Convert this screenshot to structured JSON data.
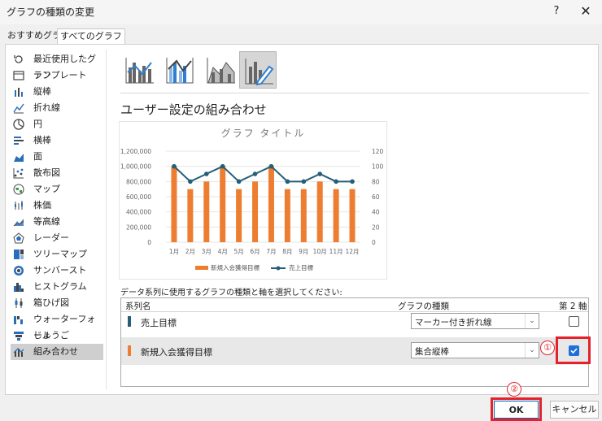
{
  "window": {
    "title": "グラフの種類の変更",
    "help": "?",
    "close": "✕"
  },
  "tabs": [
    {
      "label": "おすすめグラフ"
    },
    {
      "label": "すべてのグラフ"
    }
  ],
  "sidebar": {
    "items": [
      {
        "label": "最近使用したグラフ",
        "icon": "recent-icon"
      },
      {
        "label": "テンプレート",
        "icon": "template-icon"
      },
      {
        "label": "縦棒",
        "icon": "column-chart-icon"
      },
      {
        "label": "折れ線",
        "icon": "line-chart-icon"
      },
      {
        "label": "円",
        "icon": "pie-chart-icon"
      },
      {
        "label": "横棒",
        "icon": "bar-chart-icon"
      },
      {
        "label": "面",
        "icon": "area-chart-icon"
      },
      {
        "label": "散布図",
        "icon": "scatter-chart-icon"
      },
      {
        "label": "マップ",
        "icon": "map-chart-icon"
      },
      {
        "label": "株価",
        "icon": "stock-chart-icon"
      },
      {
        "label": "等高線",
        "icon": "surface-chart-icon"
      },
      {
        "label": "レーダー",
        "icon": "radar-chart-icon"
      },
      {
        "label": "ツリーマップ",
        "icon": "treemap-icon"
      },
      {
        "label": "サンバースト",
        "icon": "sunburst-icon"
      },
      {
        "label": "ヒストグラム",
        "icon": "histogram-icon"
      },
      {
        "label": "箱ひげ図",
        "icon": "box-whisker-icon"
      },
      {
        "label": "ウォーターフォール",
        "icon": "waterfall-icon"
      },
      {
        "label": "じょうご",
        "icon": "funnel-icon"
      },
      {
        "label": "組み合わせ",
        "icon": "combo-chart-icon"
      }
    ],
    "selected": "組み合わせ"
  },
  "subtypes": [
    {
      "name": "clustered-column-line",
      "icon": "combo-column-line-icon"
    },
    {
      "name": "clustered-column-line-secondary",
      "icon": "combo-column-line-secondary-icon"
    },
    {
      "name": "stacked-area-column",
      "icon": "combo-area-column-icon"
    },
    {
      "name": "custom-combination",
      "icon": "custom-combo-icon"
    }
  ],
  "section_heading": "ユーザー設定の組み合わせ",
  "chart_data": {
    "type": "bar",
    "title": "グラフ タイトル",
    "categories": [
      "1月",
      "2月",
      "3月",
      "4月",
      "5月",
      "6月",
      "7月",
      "8月",
      "9月",
      "10月",
      "11月",
      "12月"
    ],
    "series": [
      {
        "name": "新規入会獲得目標",
        "type": "bar",
        "axis": "primary",
        "color": "#ed7d31",
        "values": [
          1000000,
          700000,
          800000,
          1000000,
          700000,
          800000,
          1000000,
          700000,
          700000,
          800000,
          700000,
          700000
        ]
      },
      {
        "name": "売上目標",
        "type": "line-marker",
        "axis": "secondary",
        "color": "#255e79",
        "values": [
          100,
          80,
          90,
          100,
          80,
          90,
          100,
          80,
          80,
          90,
          80,
          80
        ]
      }
    ],
    "y_primary": {
      "ylim": [
        0,
        1200000
      ],
      "ticks": [
        "0",
        "200,000",
        "400,000",
        "600,000",
        "800,000",
        "1,000,000",
        "1,200,000"
      ]
    },
    "y_secondary": {
      "ylim": [
        0,
        120
      ],
      "ticks": [
        "0",
        "20",
        "40",
        "60",
        "80",
        "100",
        "120"
      ]
    },
    "grid": true,
    "legend": "bottom"
  },
  "series_prompt": "データ系列に使用するグラフの種類と軸を選択してください:",
  "series_table": {
    "headers": {
      "name": "系列名",
      "type": "グラフの種類",
      "axis": "第 2 軸"
    },
    "rows": [
      {
        "name": "売上目標",
        "color": "#255e79",
        "chart_type": "マーカー付き折れ線",
        "secondary": false
      },
      {
        "name": "新規入会獲得目標",
        "color": "#ed7d31",
        "chart_type": "集合縦棒",
        "secondary": true
      }
    ]
  },
  "annotations": {
    "one": "①",
    "two": "②"
  },
  "buttons": {
    "ok": "OK",
    "cancel": "キャンセル"
  }
}
